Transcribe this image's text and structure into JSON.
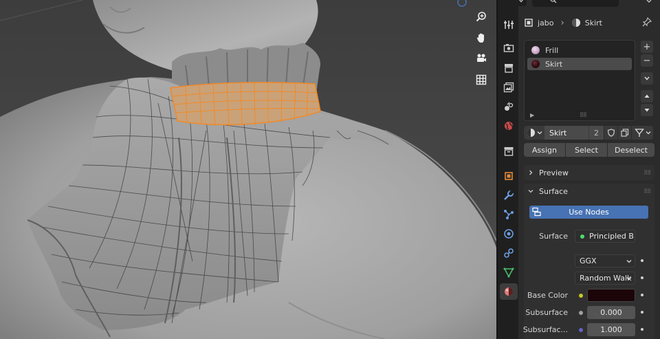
{
  "header": {
    "search_placeholder": ""
  },
  "breadcrumb": {
    "object": "jabo",
    "material": "Skirt"
  },
  "material_slots": [
    {
      "name": "Frill",
      "color": "#caa7c6",
      "selected": false
    },
    {
      "name": "Skirt",
      "color": "#2a0a10",
      "selected": true
    }
  ],
  "slot_buttons": {
    "add": "+",
    "remove": "−"
  },
  "material": {
    "name": "Skirt",
    "users": "2"
  },
  "assign_buttons": {
    "assign": "Assign",
    "select": "Select",
    "deselect": "Deselect"
  },
  "panels": {
    "preview": "Preview",
    "surface": "Surface"
  },
  "surface": {
    "use_nodes_label": "Use Nodes",
    "surface_label": "Surface",
    "surface_shader": "Principled B...",
    "distribution": "GGX",
    "subsurface_method": "Random Walk",
    "base_color_label": "Base Color",
    "base_color": "#1c0509",
    "subsurface_label": "Subsurface",
    "subsurface_value": "0.000",
    "subsurface_radius_label": "Subsurfac...",
    "subsurface_radius_value": "1.000"
  },
  "colors": {
    "accent": "#4772b3",
    "selection_orange": "#f08a28",
    "viewport_bg": "#4a4a4a"
  }
}
